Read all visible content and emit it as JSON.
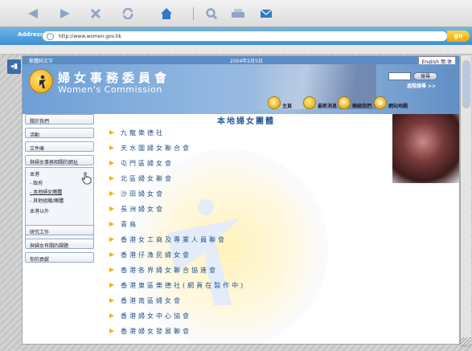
{
  "browser": {
    "address_label": "Address:",
    "url": "http://www.women.gov.hk",
    "go_label": "go",
    "toolbar_icons": [
      "back-arrow-icon",
      "forward-arrow-icon",
      "stop-x-icon",
      "refresh-icon",
      "home-icon",
      "search-icon",
      "print-icon",
      "mail-icon"
    ]
  },
  "header": {
    "lang_left": "繁體純文字",
    "date": "2004年2月5日",
    "lang_right": "English 簡 体",
    "title_cn": "婦女事務委員會",
    "title_en": "Women's Commission",
    "search_button": "搜尋",
    "advanced_search": "進階搜尋 >>"
  },
  "nav": {
    "items": [
      {
        "label": "主頁",
        "icon": "home-icon"
      },
      {
        "label": "最新消息",
        "icon": "info-icon"
      },
      {
        "label": "聯絡我們",
        "icon": "mail-icon"
      },
      {
        "label": "網站地圖",
        "icon": "sitemap-icon"
      }
    ]
  },
  "sidebar": {
    "items": [
      {
        "label": "關於我們"
      },
      {
        "label": "活動"
      },
      {
        "label": "文件庫"
      },
      {
        "label": "與婦女事務相關的網址"
      },
      {
        "label": "研究工作"
      },
      {
        "label": "與婦女有關的課題"
      },
      {
        "label": "你的貢獻"
      }
    ],
    "sub_items": [
      "本港",
      "- 政府",
      "- 本地婦女團體",
      "- 其他組織/團體",
      "本港以外"
    ]
  },
  "main": {
    "title": "本地婦女團體",
    "organizations": [
      "九龍樂德社",
      "天水圍婦女聯合會",
      "屯門區婦女會",
      "北區婦女聯會",
      "沙田婦女會",
      "長洲婦女會",
      "青鳥",
      "香港女工商及專業人員聯會",
      "香港仔漁民婦女會",
      "香港各界婦女聯合協進會",
      "香港東區樂德社(網頁在製作中)",
      "香港南區婦女會",
      "香港婦女中心協會",
      "香港婦女發展聯會"
    ]
  },
  "colors": {
    "brand_blue": "#5b8cc4",
    "link_blue": "#1f4f8a",
    "bullet_gold": "#f0b400",
    "address_bar": "#3f8fd1"
  }
}
